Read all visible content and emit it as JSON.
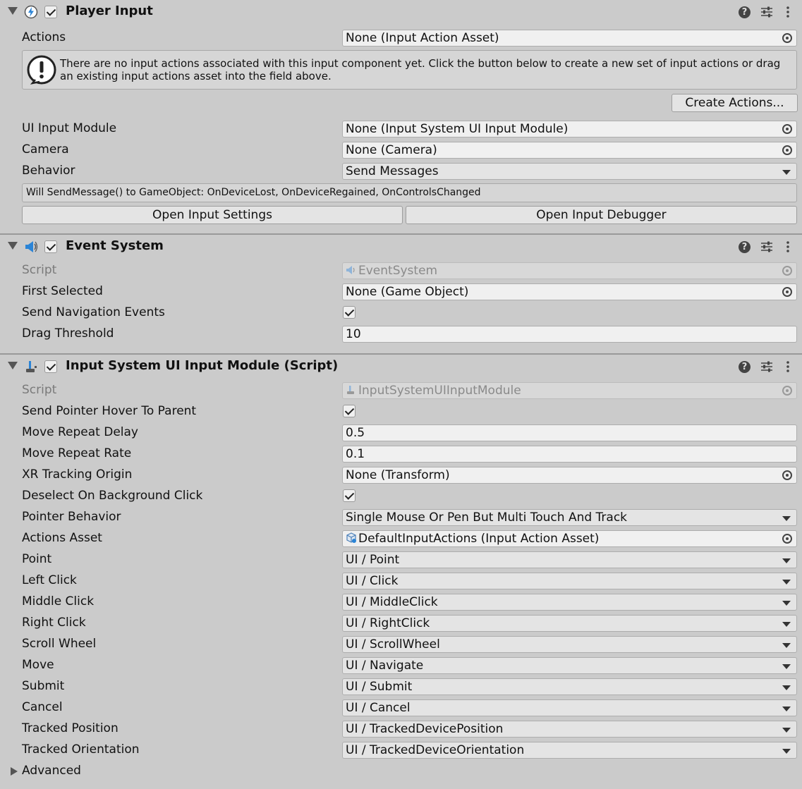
{
  "player_input": {
    "title": "Player Input",
    "actions_label": "Actions",
    "actions_value": "None (Input Action Asset)",
    "help_text": "There are no input actions associated with this input component yet. Click the button below to create a new set of input actions or drag an existing input actions asset into the field above.",
    "create_actions": "Create Actions...",
    "ui_input_module_label": "UI Input Module",
    "ui_input_module_value": "None (Input System UI Input Module)",
    "camera_label": "Camera",
    "camera_value": "None (Camera)",
    "behavior_label": "Behavior",
    "behavior_value": "Send Messages",
    "behavior_info": "Will SendMessage() to GameObject: OnDeviceLost, OnDeviceRegained, OnControlsChanged",
    "open_settings": "Open Input Settings",
    "open_debugger": "Open Input Debugger"
  },
  "event_system": {
    "title": "Event System",
    "script_label": "Script",
    "script_value": "EventSystem",
    "first_selected_label": "First Selected",
    "first_selected_value": "None (Game Object)",
    "send_nav_label": "Send Navigation Events",
    "send_nav_checked": true,
    "drag_threshold_label": "Drag Threshold",
    "drag_threshold_value": "10"
  },
  "ui_module": {
    "title": "Input System UI Input Module (Script)",
    "script_label": "Script",
    "script_value": "InputSystemUIInputModule",
    "hover_label": "Send Pointer Hover To Parent",
    "move_delay_label": "Move Repeat Delay",
    "move_delay_value": "0.5",
    "move_rate_label": "Move Repeat Rate",
    "move_rate_value": "0.1",
    "xr_label": "XR Tracking Origin",
    "xr_value": "None (Transform)",
    "deselect_label": "Deselect On Background Click",
    "pointer_behavior_label": "Pointer Behavior",
    "pointer_behavior_value": "Single Mouse Or Pen But Multi Touch And Track",
    "actions_asset_label": "Actions Asset",
    "actions_asset_value": "DefaultInputActions (Input Action Asset)",
    "bindings": [
      {
        "label": "Point",
        "value": "UI / Point"
      },
      {
        "label": "Left Click",
        "value": "UI / Click"
      },
      {
        "label": "Middle Click",
        "value": "UI / MiddleClick"
      },
      {
        "label": "Right Click",
        "value": "UI / RightClick"
      },
      {
        "label": "Scroll Wheel",
        "value": "UI / ScrollWheel"
      },
      {
        "label": "Move",
        "value": "UI / Navigate"
      },
      {
        "label": "Submit",
        "value": "UI / Submit"
      },
      {
        "label": "Cancel",
        "value": "UI / Cancel"
      },
      {
        "label": "Tracked Position",
        "value": "UI / TrackedDevicePosition"
      },
      {
        "label": "Tracked Orientation",
        "value": "UI / TrackedDeviceOrientation"
      }
    ],
    "advanced_label": "Advanced"
  }
}
